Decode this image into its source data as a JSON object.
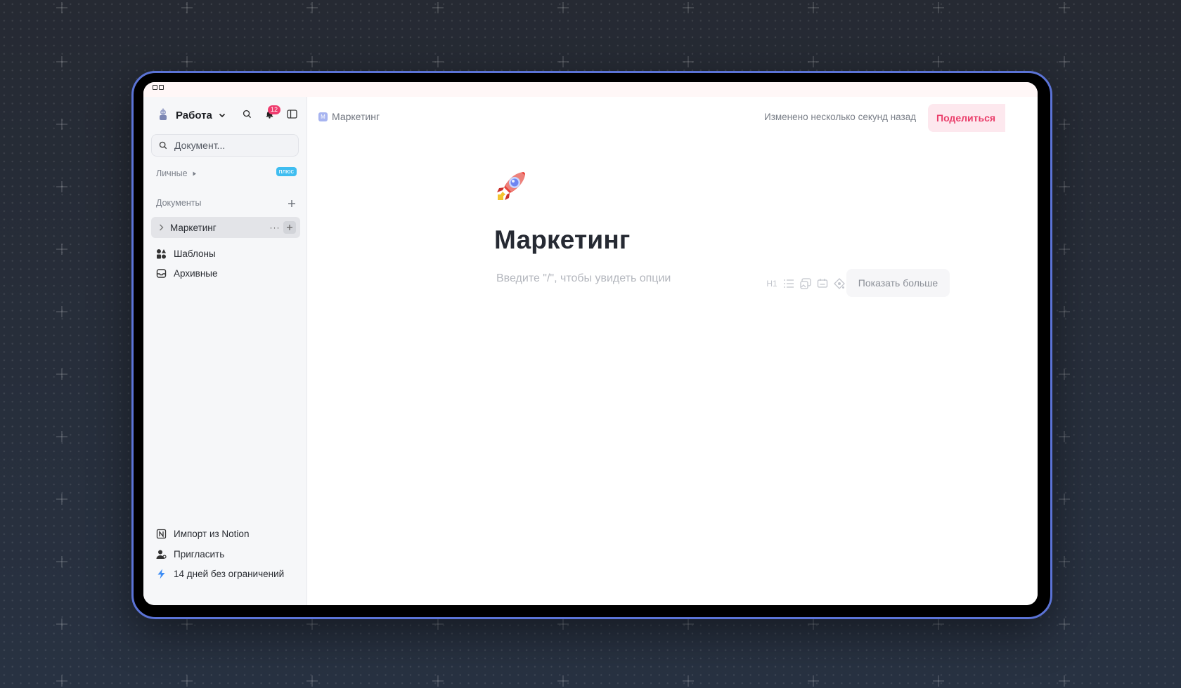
{
  "workspace": {
    "name": "Работа",
    "notifications_count": "12"
  },
  "search": {
    "placeholder": "Документ..."
  },
  "sections": {
    "personal": {
      "label": "Личные",
      "badge": "плюс"
    },
    "documents": {
      "label": "Документы"
    }
  },
  "documents": [
    {
      "label": "Маркетинг"
    }
  ],
  "nav": {
    "templates": "Шаблоны",
    "archived": "Архивные"
  },
  "footer": {
    "import": "Импорт из Notion",
    "invite": "Пригласить",
    "trial": "14 дней без ограничений"
  },
  "header": {
    "breadcrumb": "Маркетинг",
    "breadcrumb_icon_letter": "М",
    "modified": "Изменено несколько секунд назад",
    "share": "Поделиться"
  },
  "doc": {
    "title": "Маркетинг",
    "emoji": "rocket",
    "placeholder": "Введите \"/\", чтобы увидеть опции",
    "toolbar": [
      "heading-1-icon",
      "list-icon",
      "image-icon",
      "embed-icon",
      "template-icon"
    ],
    "heading_label": "H1",
    "show_more": "Показать больше"
  },
  "colors": {
    "accent": "#ea3d6a",
    "frame": "#5b73d6",
    "badge": "#ef3c6e",
    "plus_pill": "#3fbdf0"
  }
}
